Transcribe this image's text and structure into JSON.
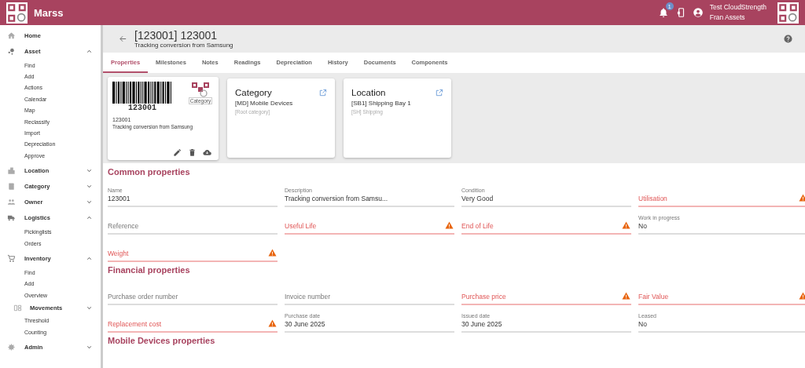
{
  "app": {
    "name": "Marss",
    "notifications": "1",
    "user_name": "Test CloudStrength",
    "user_org": "Fran Assets"
  },
  "sidebar": {
    "items": [
      {
        "label": "Home"
      },
      {
        "label": "Asset",
        "expanded": true,
        "children": [
          {
            "label": "Find"
          },
          {
            "label": "Add"
          },
          {
            "label": "Actions"
          },
          {
            "label": "Calendar"
          },
          {
            "label": "Map"
          },
          {
            "label": "Reclassify"
          },
          {
            "label": "Import"
          },
          {
            "label": "Depreciation"
          },
          {
            "label": "Approve"
          }
        ]
      },
      {
        "label": "Location",
        "expanded": false
      },
      {
        "label": "Category",
        "expanded": false
      },
      {
        "label": "Owner",
        "expanded": false
      },
      {
        "label": "Logistics",
        "expanded": true,
        "children": [
          {
            "label": "Pickinglists"
          },
          {
            "label": "Orders"
          }
        ]
      },
      {
        "label": "Inventory",
        "expanded": true,
        "children": [
          {
            "label": "Find"
          },
          {
            "label": "Add"
          },
          {
            "label": "Overview"
          },
          {
            "label": "Movements",
            "kind": "group",
            "expanded": false
          },
          {
            "label": "Threshold"
          },
          {
            "label": "Counting"
          }
        ]
      },
      {
        "label": "Admin",
        "expanded": false
      }
    ]
  },
  "header": {
    "title": "[123001] 123001",
    "subtitle": "Tracking conversion from Samsung"
  },
  "tabs": [
    {
      "label": "Properties",
      "selected": true
    },
    {
      "label": "Milestones",
      "selected": false
    },
    {
      "label": "Notes",
      "selected": false
    },
    {
      "label": "Readings",
      "selected": false
    },
    {
      "label": "Depreciation",
      "selected": false
    },
    {
      "label": "History",
      "selected": false
    },
    {
      "label": "Documents",
      "selected": false
    },
    {
      "label": "Components",
      "selected": false
    }
  ],
  "asset_card": {
    "barcode": "123001",
    "logo_caption": "Category",
    "name": "123001",
    "description": "Tracking conversion from Samsung"
  },
  "link_cards": [
    {
      "title": "Category",
      "value": "[MD] Mobile Devices",
      "parent": "[Root category]"
    },
    {
      "title": "Location",
      "value": "[SB1] Shipping Bay 1",
      "parent": "[SH] Shipping"
    }
  ],
  "sections": [
    {
      "title": "Common properties",
      "fields": [
        {
          "label": "Name",
          "value": "123001",
          "error": false
        },
        {
          "label": "Description",
          "value": "Tracking conversion from Samsu...",
          "error": false
        },
        {
          "label": "Condition",
          "value": "Very Good",
          "error": false
        },
        {
          "label": "Utilisation",
          "error": true
        },
        {
          "label": "Reference",
          "error": false
        },
        {
          "label": "Useful Life",
          "error": true
        },
        {
          "label": "End of Life",
          "error": true
        },
        {
          "label": "Work in progress",
          "value": "No",
          "error": false
        },
        {
          "label": "Weight",
          "error": true
        }
      ]
    },
    {
      "title": "Financial properties",
      "fields": [
        {
          "label": "Purchase order number",
          "error": false
        },
        {
          "label": "Invoice number",
          "error": false
        },
        {
          "label": "Purchase price",
          "error": true
        },
        {
          "label": "Fair Value",
          "error": true
        },
        {
          "label": "Replacement cost",
          "error": true
        },
        {
          "label": "Purchase date",
          "value": "30 June 2025",
          "error": false
        },
        {
          "label": "Issued date",
          "value": "30 June 2025",
          "error": false
        },
        {
          "label": "Leased",
          "value": "No",
          "error": false
        }
      ]
    },
    {
      "title": "Mobile Devices properties"
    }
  ]
}
